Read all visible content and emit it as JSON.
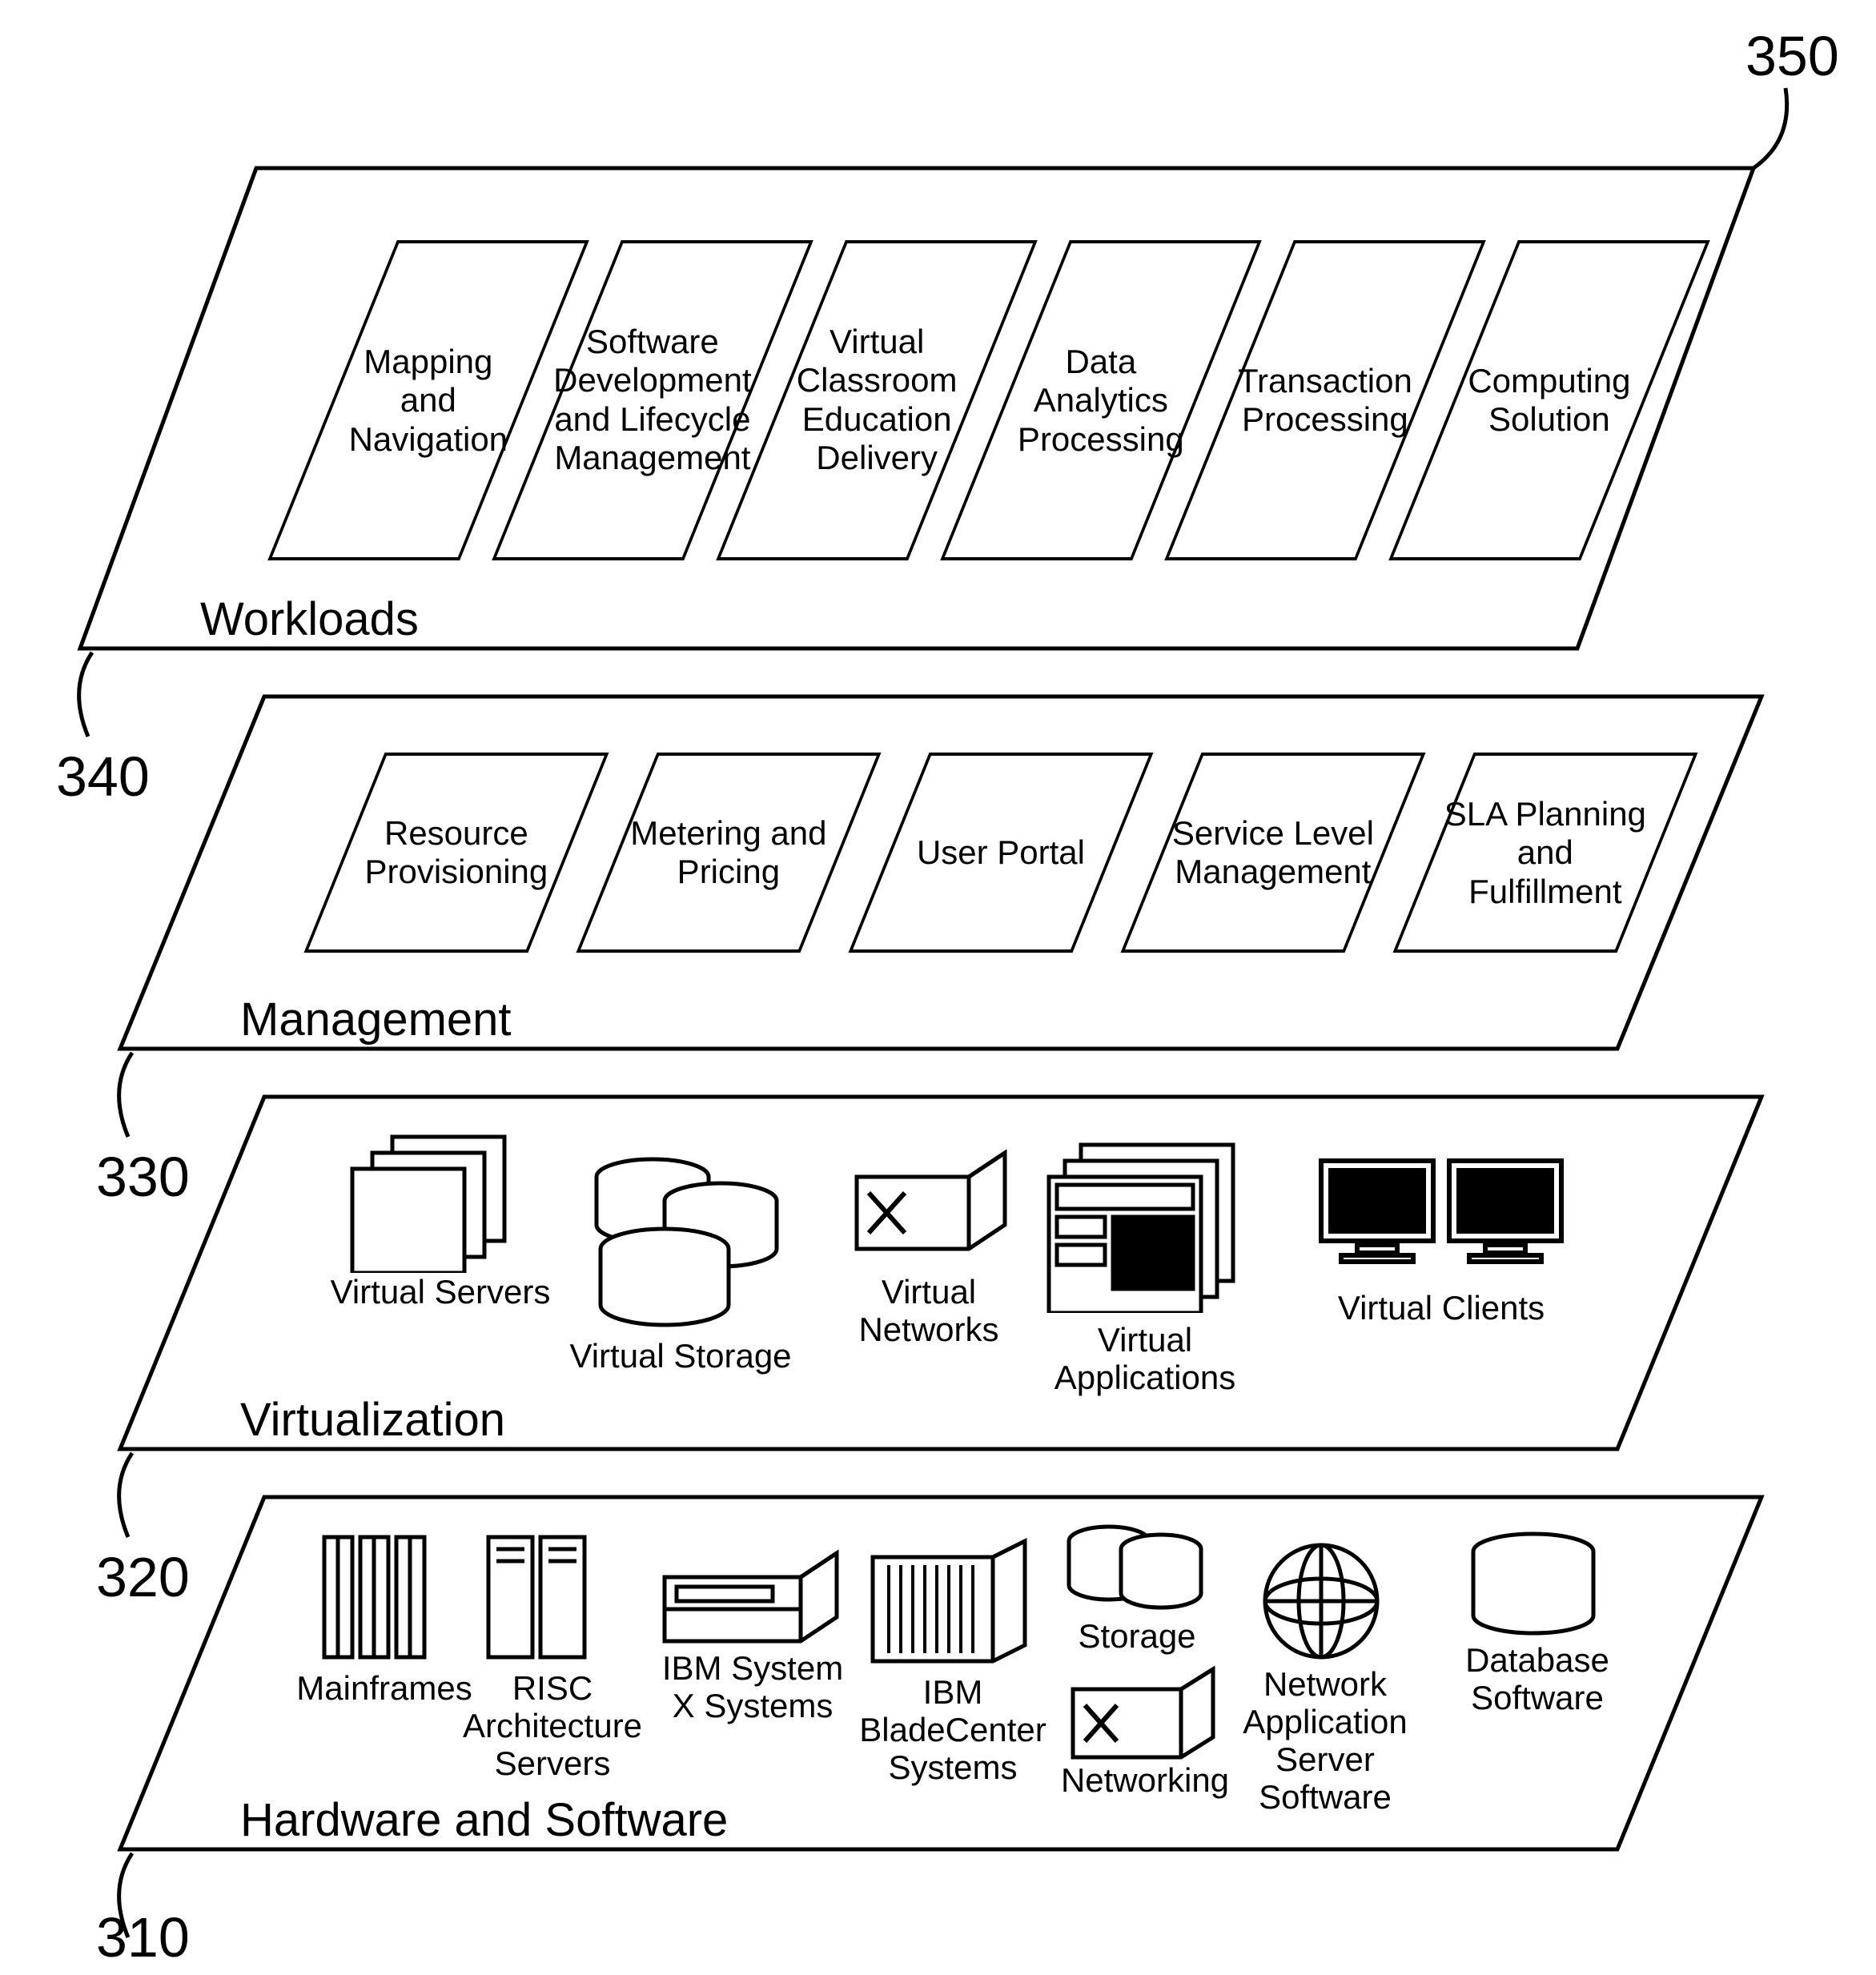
{
  "refs": {
    "r350": "350",
    "r340": "340",
    "r330": "330",
    "r320": "320",
    "r310": "310"
  },
  "layers": {
    "workloads": {
      "title": "Workloads",
      "items": [
        "Mapping and Navigation",
        "Software Development and Lifecycle Management",
        "Virtual Classroom Education Delivery",
        "Data Analytics Processing",
        "Transaction Processing",
        "Computing Solution"
      ]
    },
    "management": {
      "title": "Management",
      "items": [
        "Resource Provisioning",
        "Metering and Pricing",
        "User Portal",
        "Service Level Management",
        "SLA Planning and Fulfillment"
      ]
    },
    "virtualization": {
      "title": "Virtualization",
      "items": [
        "Virtual Servers",
        "Virtual Storage",
        "Virtual Networks",
        "Virtual Applications",
        "Virtual Clients"
      ]
    },
    "hardware": {
      "title": "Hardware and Software",
      "items": [
        "Mainframes",
        "RISC Architecture Servers",
        "IBM System X Systems",
        "IBM BladeCenter Systems",
        "Storage",
        "Networking",
        "Network Application Server Software",
        "Database Software"
      ]
    }
  }
}
